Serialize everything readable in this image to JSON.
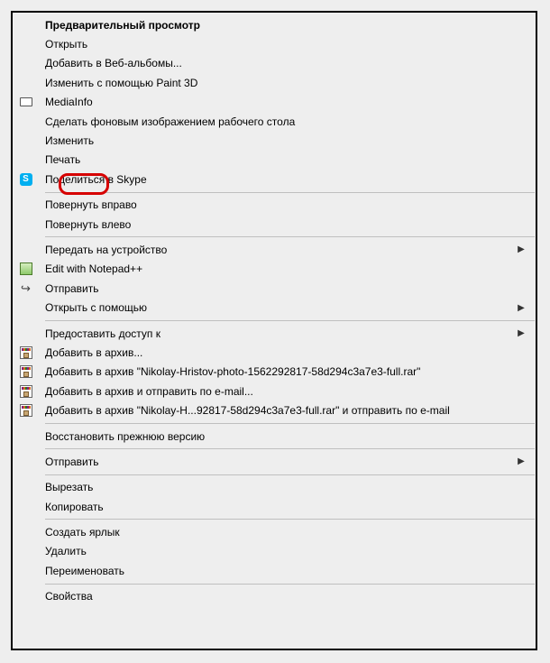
{
  "items": [
    {
      "label": "Предварительный просмотр",
      "icon": null,
      "bold": true,
      "sub": false,
      "sep": false
    },
    {
      "label": "Открыть",
      "icon": null,
      "sub": false,
      "sep": false
    },
    {
      "label": "Добавить в Веб-альбомы...",
      "icon": null,
      "sub": false,
      "sep": false
    },
    {
      "label": "Изменить с помощью Paint 3D",
      "icon": null,
      "sub": false,
      "sep": false
    },
    {
      "label": "MediaInfo",
      "icon": "media",
      "sub": false,
      "sep": false
    },
    {
      "label": "Сделать фоновым изображением рабочего стола",
      "icon": null,
      "sub": false,
      "sep": false
    },
    {
      "label": "Изменить",
      "icon": null,
      "sub": false,
      "sep": false
    },
    {
      "label": "Печать",
      "icon": null,
      "sub": false,
      "sep": false
    },
    {
      "label": "Поделиться в Skype",
      "icon": "skype",
      "skypeLetter": "S",
      "sub": false,
      "sep": false
    },
    {
      "sep": true
    },
    {
      "label": "Повернуть вправо",
      "icon": null,
      "sub": false,
      "sep": false
    },
    {
      "label": "Повернуть влево",
      "icon": null,
      "sub": false,
      "sep": false
    },
    {
      "sep": true
    },
    {
      "label": "Передать на устройство",
      "icon": null,
      "sub": true,
      "sep": false
    },
    {
      "label": "Edit with Notepad++",
      "icon": "npp",
      "sub": false,
      "sep": false
    },
    {
      "label": "Отправить",
      "icon": "share",
      "shareGlyph": "↪",
      "sub": false,
      "sep": false
    },
    {
      "label": "Открыть с помощью",
      "icon": null,
      "sub": true,
      "sep": false
    },
    {
      "sep": true
    },
    {
      "label": "Предоставить доступ к",
      "icon": null,
      "sub": true,
      "sep": false
    },
    {
      "label": "Добавить в архив...",
      "icon": "rar",
      "sub": false,
      "sep": false
    },
    {
      "label": "Добавить в архив \"Nikolay-Hristov-photo-1562292817-58d294c3a7e3-full.rar\"",
      "icon": "rar",
      "sub": false,
      "sep": false
    },
    {
      "label": "Добавить в архив и отправить по e-mail...",
      "icon": "rar",
      "sub": false,
      "sep": false
    },
    {
      "label": "Добавить в архив \"Nikolay-H...92817-58d294c3a7e3-full.rar\" и отправить по e-mail",
      "icon": "rar",
      "sub": false,
      "sep": false
    },
    {
      "sep": true
    },
    {
      "label": "Восстановить прежнюю версию",
      "icon": null,
      "sub": false,
      "sep": false
    },
    {
      "sep": true
    },
    {
      "label": "Отправить",
      "icon": null,
      "sub": true,
      "sep": false
    },
    {
      "sep": true
    },
    {
      "label": "Вырезать",
      "icon": null,
      "sub": false,
      "sep": false
    },
    {
      "label": "Копировать",
      "icon": null,
      "sub": false,
      "sep": false
    },
    {
      "sep": true
    },
    {
      "label": "Создать ярлык",
      "icon": null,
      "sub": false,
      "sep": false
    },
    {
      "label": "Удалить",
      "icon": null,
      "sub": false,
      "sep": false
    },
    {
      "label": "Переименовать",
      "icon": null,
      "sub": false,
      "sep": false
    },
    {
      "sep": true
    },
    {
      "label": "Свойства",
      "icon": null,
      "sub": false,
      "sep": false
    }
  ],
  "arrowGlyph": "▶"
}
